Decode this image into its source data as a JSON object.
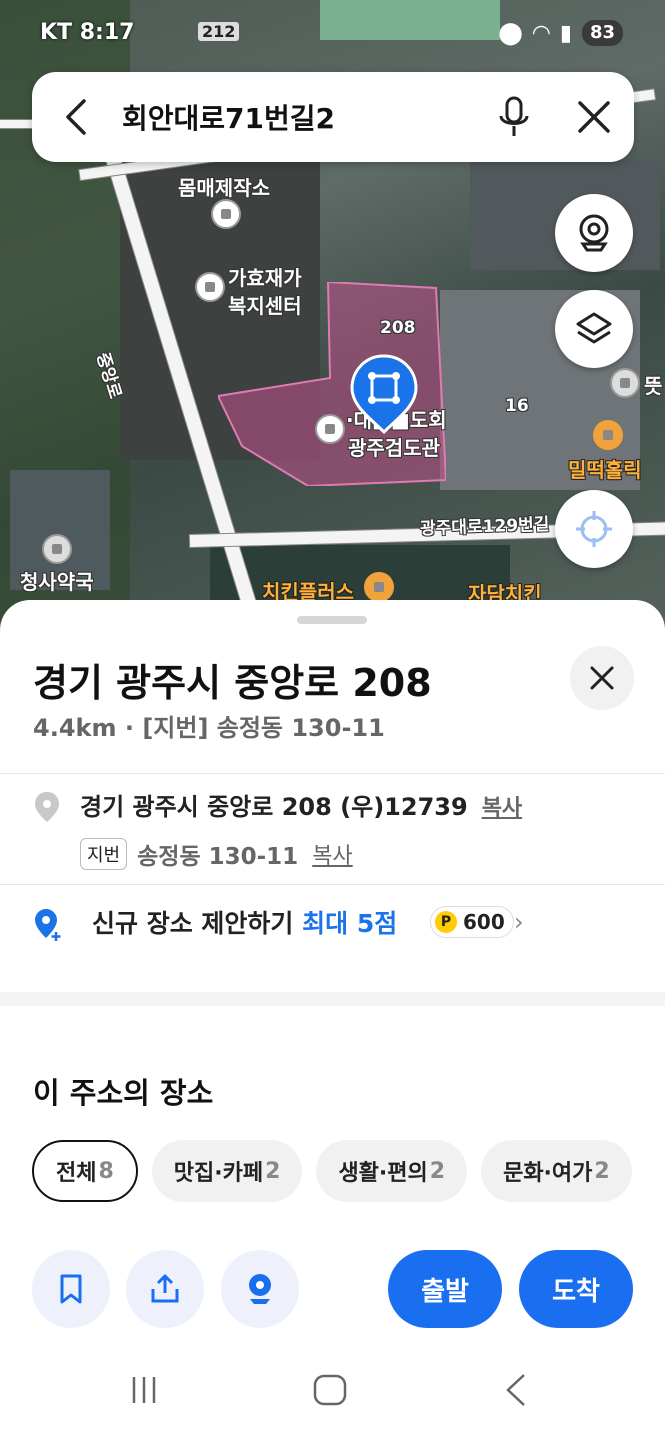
{
  "status_bar": {
    "carrier_time": "KT 8:17",
    "app_badge": "212",
    "battery": "83"
  },
  "search": {
    "query": "회안대로71번길2"
  },
  "map": {
    "labels": {
      "factory": "몸매제작소",
      "welfare_line1": "가효재가",
      "welfare_line2": "복지센터",
      "parcel_number": "208",
      "building_16": "16",
      "kendo_line1": "·대■■도회",
      "kendo_line2": "광주검도관",
      "restaurant": "밀떡홀릭",
      "road_right": "광주대로129번길",
      "road_left": "중앙로",
      "pharmacy": "청사약국",
      "chicken_plus": "치킨플러스",
      "jadam_chicken": "자담치킨",
      "partial_right": "뜻"
    }
  },
  "sheet": {
    "title": "경기 광주시 중앙로 208",
    "subtitle": "4.4km · [지번] 송정동 130-11",
    "address_line": "경기 광주시 중앙로 208 (우)12739",
    "copy_label": "복사",
    "jibun_tag": "지번",
    "jibun_address": "송정동 130-11",
    "suggest_text": "신규 장소 제안하기",
    "suggest_highlight": "최대 5점",
    "points": "600",
    "point_symbol": "P",
    "section_title": "이 주소의 장소",
    "chips": [
      {
        "label": "전체",
        "count": "8"
      },
      {
        "label": "맛집·카페",
        "count": "2"
      },
      {
        "label": "생활·편의",
        "count": "2"
      },
      {
        "label": "문화·여가",
        "count": "2"
      }
    ],
    "depart_label": "출발",
    "arrive_label": "도착"
  },
  "colors": {
    "accent_blue": "#1a6ff0",
    "parcel_pink": "#c0508a",
    "pin_blue": "#1a73e8"
  },
  "icons": [
    "back-arrow-icon",
    "mic-icon",
    "close-icon",
    "street-view-icon",
    "layers-icon",
    "my-location-icon",
    "location-pin-icon",
    "add-place-icon",
    "bookmark-icon",
    "share-icon",
    "place-pin-icon"
  ]
}
